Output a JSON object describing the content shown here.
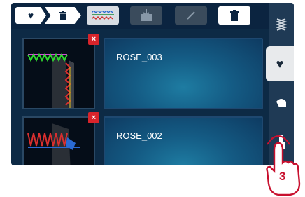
{
  "toolbar": {
    "crumbs": [
      {
        "icon": "heart-icon"
      },
      {
        "icon": "trash-icon"
      }
    ],
    "buttons": [
      {
        "icon": "stitch-pattern-icon",
        "state": "selected"
      },
      {
        "icon": "import-icon",
        "state": "disabled"
      },
      {
        "icon": "pencil-icon",
        "state": "disabled"
      },
      {
        "icon": "trash-icon",
        "state": "enabled"
      }
    ]
  },
  "sidebar": {
    "tabs": [
      {
        "icon": "stitch-icon"
      },
      {
        "icon": "heart-icon",
        "state": "active"
      },
      {
        "icon": "hoop-icon"
      },
      {
        "icon": "usb-icon"
      }
    ]
  },
  "list": {
    "items": [
      {
        "name": "ROSE_003",
        "delete_label": "×"
      },
      {
        "name": "ROSE_002",
        "delete_label": "×"
      }
    ]
  },
  "callout": {
    "step": "3"
  },
  "colors": {
    "background": "#0d2a45",
    "accent_red": "#d8242b",
    "item_blue": "#145b84",
    "callout_red": "#c8102e"
  }
}
